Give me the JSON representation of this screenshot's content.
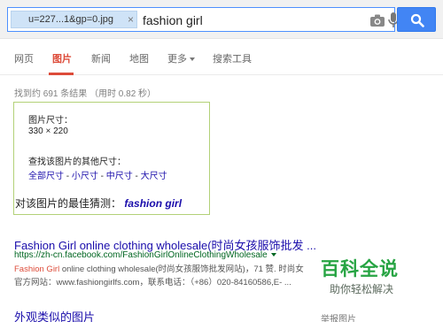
{
  "search": {
    "image_chip": "u=227...1&gp=0.jpg",
    "chip_close": "×",
    "query": "fashion girl"
  },
  "tabs": [
    {
      "label": "网页",
      "active": false
    },
    {
      "label": "图片",
      "active": true
    },
    {
      "label": "新闻",
      "active": false
    },
    {
      "label": "地图",
      "active": false
    },
    {
      "label": "更多",
      "active": false
    },
    {
      "label": "搜索工具",
      "active": false
    }
  ],
  "stats": "找到约 691 条结果 （用时 0.82 秒）",
  "image_info": {
    "size_label": "图片尺寸：",
    "size_value": "330 × 220",
    "other_sizes_label": "查找该图片的其他尺寸：",
    "size_links": [
      "全部尺寸",
      "小尺寸",
      "中尺寸",
      "大尺寸"
    ],
    "separator": " - ",
    "best_guess_label": "对该图片的最佳猜测：",
    "best_guess_value": "fashion girl"
  },
  "result": {
    "title": "Fashion Girl online clothing wholesale(时尚女孩服饰批发 ...",
    "url": "https://zh-cn.facebook.com/FashionGirlOnlineClothingWholesale",
    "snippet1_em": "Fashion Girl",
    "snippet1_rest": " online clothing wholesale(时尚女孩服饰批发网站)，71 赞. 时尚女",
    "snippet2": "官方网站：www.fashiongirlfs.com，联系电话：（+86）020-84160586,E- ..."
  },
  "similar": {
    "header": "外观类似的图片",
    "report": "举报图片"
  },
  "watermark": {
    "title": "百科全说",
    "subtitle": "助你轻松解决"
  },
  "colors": {
    "accent_red": "#dd4b39",
    "link_blue": "#1a0dab",
    "url_green": "#006621",
    "search_blue": "#4285f4",
    "card_border": "#b3d178",
    "watermark_green": "#27a443"
  }
}
